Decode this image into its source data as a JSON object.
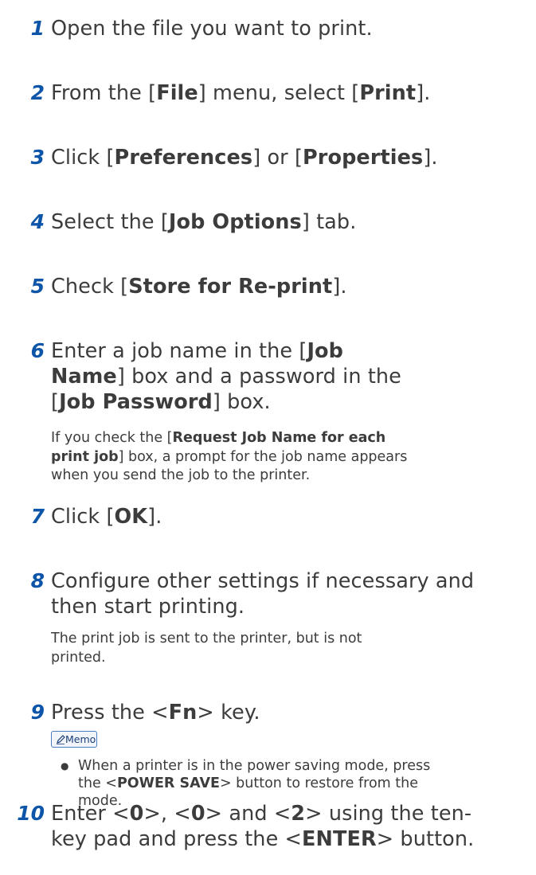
{
  "steps": [
    {
      "num": "1",
      "parts": [
        {
          "t": "Open the file you want to print."
        }
      ]
    },
    {
      "num": "2",
      "parts": [
        {
          "t": "From the ["
        },
        {
          "t": "File",
          "b": true
        },
        {
          "t": "] menu, select ["
        },
        {
          "t": "Print",
          "b": true
        },
        {
          "t": "]."
        }
      ]
    },
    {
      "num": "3",
      "parts": [
        {
          "t": "Click ["
        },
        {
          "t": "Preferences",
          "b": true
        },
        {
          "t": "] or ["
        },
        {
          "t": "Properties",
          "b": true
        },
        {
          "t": "]."
        }
      ]
    },
    {
      "num": "4",
      "parts": [
        {
          "t": "Select the ["
        },
        {
          "t": "Job Options",
          "b": true
        },
        {
          "t": "] tab."
        }
      ]
    },
    {
      "num": "5",
      "parts": [
        {
          "t": "Check ["
        },
        {
          "t": "Store for Re-print",
          "b": true
        },
        {
          "t": "]."
        }
      ]
    },
    {
      "num": "6",
      "parts": [
        {
          "t": "Enter a job name in the ["
        },
        {
          "t": "Job Name",
          "b": true
        },
        {
          "t": "] box and a password in the ["
        },
        {
          "t": "Job Password",
          "b": true
        },
        {
          "t": "] box."
        }
      ],
      "note": [
        {
          "t": "If you check the ["
        },
        {
          "t": "Request Job Name for each print job",
          "b": true
        },
        {
          "t": "] box, a prompt for the job name appears when you send the job to the printer."
        }
      ]
    },
    {
      "num": "7",
      "parts": [
        {
          "t": "Click ["
        },
        {
          "t": "OK",
          "b": true
        },
        {
          "t": "]."
        }
      ]
    },
    {
      "num": "8",
      "parts": [
        {
          "t": "Configure other settings if necessary and then start printing."
        }
      ],
      "note": [
        {
          "t": "The print job is sent to the printer, but is not printed."
        }
      ]
    },
    {
      "num": "9",
      "parts": [
        {
          "t": "Press the <"
        },
        {
          "t": "Fn",
          "b": true
        },
        {
          "t": "> key."
        }
      ],
      "memo_label": "Memo",
      "bullet": [
        {
          "t": "When a printer is in the power saving mode, press the <"
        },
        {
          "t": "POWER SAVE",
          "b": true
        },
        {
          "t": "> button to restore from the mode."
        }
      ]
    },
    {
      "num": "10",
      "parts": [
        {
          "t": "Enter <"
        },
        {
          "t": "0",
          "b": true
        },
        {
          "t": ">, <"
        },
        {
          "t": "0",
          "b": true
        },
        {
          "t": "> and <"
        },
        {
          "t": "2",
          "b": true
        },
        {
          "t": "> using the ten-key pad and press the <"
        },
        {
          "t": "ENTER",
          "b": true
        },
        {
          "t": "> button."
        }
      ]
    }
  ],
  "bullet_glyph": "●",
  "accent_color": "#0d55a8"
}
